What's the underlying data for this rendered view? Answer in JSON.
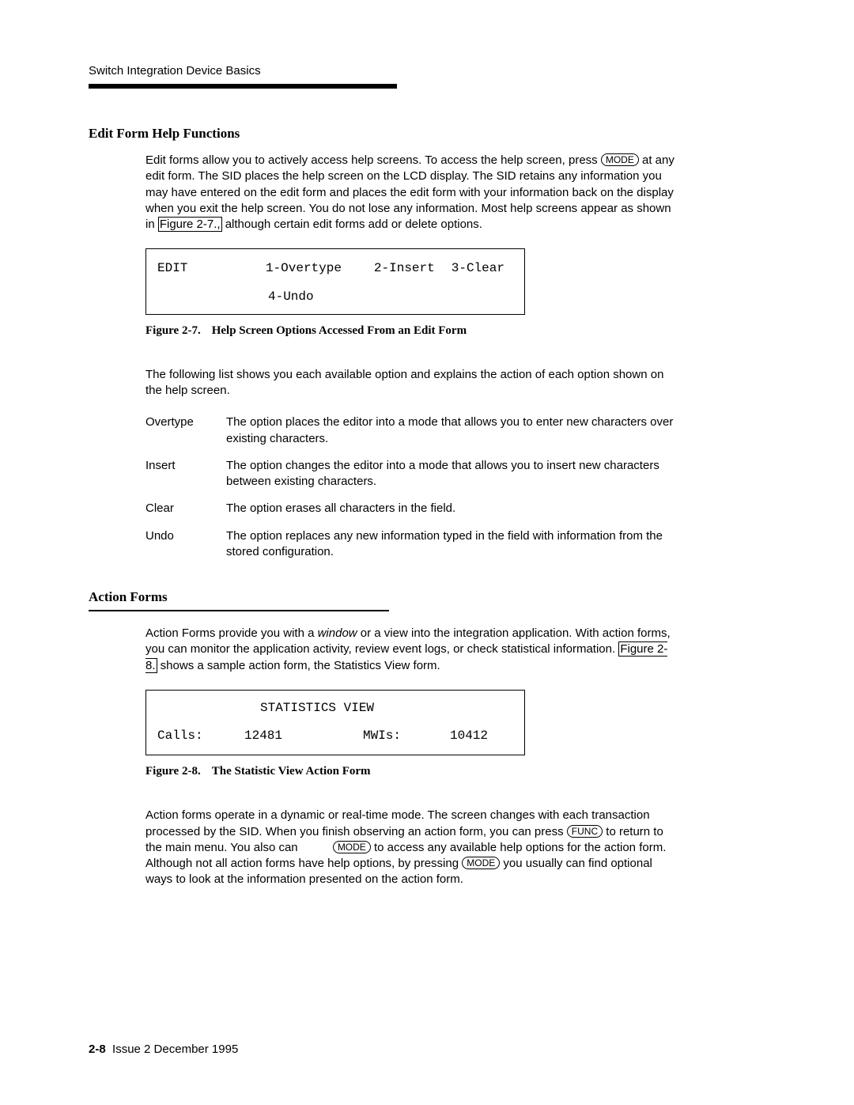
{
  "runningHead": "Switch Integration Device Basics",
  "section1": {
    "title": "Edit Form Help Functions",
    "para1a": "Edit forms allow you to actively access help screens. To access the help screen, press ",
    "key1": "MODE",
    "para1b": " at any edit form. The SID places the help screen on the LCD display. The SID retains any information you may have entered on the edit form and places the edit form with your information back on the display when you exit the help screen. You do not lose any information. Most help screens appear as shown in ",
    "figref1": "Figure 2-7.,",
    "para1c": " although certain edit forms add or delete options."
  },
  "lcd1": {
    "r1c1": "EDIT",
    "r1c2": "1-Overtype",
    "r1c3": "2-Insert",
    "r1c4": "3-Clear",
    "r2c2": "4-Undo"
  },
  "caption1": {
    "label": "Figure 2-7.",
    "text": "Help Screen Options Accessed From an Edit Form"
  },
  "midpara": "The following list shows you each available option and explains the action of each option shown on the help screen.",
  "defs": [
    {
      "term": "Overtype",
      "text": "The option places the editor into a mode that allows you to enter new characters over existing characters."
    },
    {
      "term": "Insert",
      "text": "The option changes the editor into a mode that allows you to insert new characters between existing characters."
    },
    {
      "term": "Clear",
      "text": "The option erases all characters in the field."
    },
    {
      "term": "Undo",
      "text": "The option replaces any new information typed in the field with information from the stored configuration."
    }
  ],
  "section2": {
    "title": "Action Forms",
    "p1a": "Action Forms provide you with a ",
    "p1italic": "window",
    "p1b": " or a view into the integration application. With action forms, you can monitor the application activity, review event logs, or check statistical information. ",
    "figref2": "Figure 2-8.",
    "p1c": " shows a sample action form, the Statistics View form."
  },
  "lcd2": {
    "title": "STATISTICS VIEW",
    "c1": "Calls:",
    "c2": "12481",
    "c3": "MWIs:",
    "c4": "10412"
  },
  "caption2": {
    "label": "Figure 2-8.",
    "text": "The Statistic View Action Form"
  },
  "para3": {
    "a": "Action forms operate in a dynamic or real-time mode. The screen changes with each transaction processed by the SID. When you finish observing an action form, you can press ",
    "keyFunc": "FUNC",
    "b": " to return to the main menu. You also can ",
    "keyMode1": "MODE",
    "c": " to access any available help options for the action form. Although not all action forms have help options, by pressing ",
    "keyMode2": "MODE",
    "d": " you usually can find optional ways to look at the information presented on the action form."
  },
  "footer": {
    "page": "2-8",
    "issue": "Issue 2   December 1995"
  }
}
